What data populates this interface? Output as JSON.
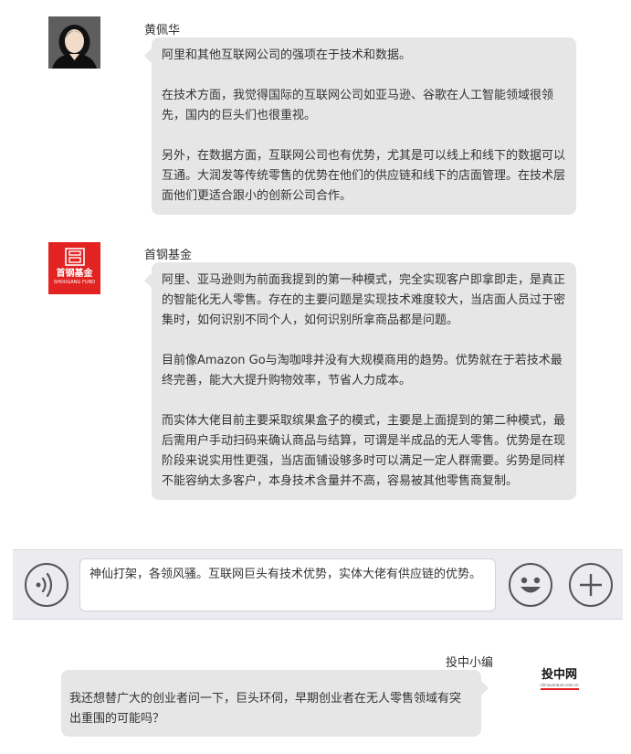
{
  "messages": [
    {
      "sender": "黄佩华",
      "paragraphs": [
        "阿里和其他互联网公司的强项在于技术和数据。",
        "在技术方面，我觉得国际的互联网公司如亚马逊、谷歌在人工智能领域很领先，国内的巨头们也很重视。",
        "另外，在数据方面，互联网公司也有优势，尤其是可以线上和线下的数据可以互通。大润发等传统零售的优势在他们的供应链和线下的店面管理。在技术层面他们更适合跟小的创新公司合作。"
      ]
    },
    {
      "sender": "首钢基金",
      "avatar": {
        "cn": "首钢基金",
        "en": "SHOUGANG FUND",
        "color": "#e32222"
      },
      "paragraphs": [
        "阿里、亚马逊则为前面我提到的第一种模式，完全实现客户即拿即走，是真正的智能化无人零售。存在的主要问题是实现技术难度较大，当店面人员过于密集时，如何识别不同个人，如何识别所拿商品都是问题。",
        "目前像Amazon Go与淘咖啡并没有大规模商用的趋势。优势就在于若技术最终完善，能大大提升购物效率，节省人力成本。",
        "而实体大佬目前主要采取缤果盒子的模式，主要是上面提到的第二种模式，最后需用户手动扫码来确认商品与结算，可谓是半成品的无人零售。优势是在现阶段来说实用性更强，当店面铺设够多时可以满足一定人群需要。劣势是同样不能容纳太多客户，本身技术含量并不高，容易被其他零售商复制。"
      ]
    }
  ],
  "input_bar": {
    "text": "神仙打架，各领风骚。互联网巨头有技术优势，实体大佬有供应链的优势。",
    "voice_icon": "voice-wave-icon",
    "emoji_icon": "smiley-face-icon",
    "plus_icon": "plus-icon"
  },
  "outgoing": {
    "sender": "投中小编",
    "text": "我还想替广大的创业者问一下，巨头环伺，早期创业者在无人零售领域有突出重围的可能吗？",
    "logo": {
      "main": "投中网",
      "sub": "chinaventure.com.cn"
    }
  },
  "colors": {
    "bubble": "#e6e6e6",
    "input_bar": "#ebebf0",
    "brand_red": "#e32222"
  }
}
